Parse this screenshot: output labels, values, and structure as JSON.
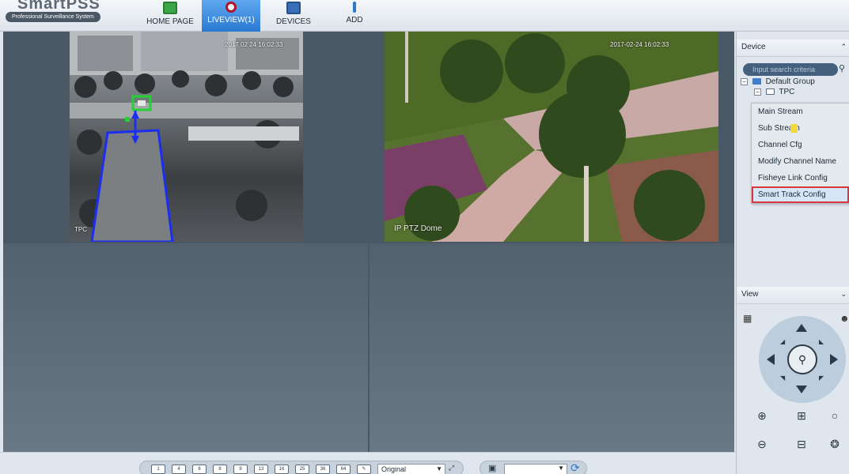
{
  "app": {
    "logo_text": "SmartPSS",
    "subtitle": "Professional Surveillance System"
  },
  "nav": {
    "tabs": [
      {
        "label": "HOME PAGE",
        "icon": "home-icon"
      },
      {
        "label": "LIVEVIEW(1)",
        "icon": "record-icon"
      },
      {
        "label": "DEVICES",
        "icon": "monitor-icon"
      },
      {
        "label": "ADD",
        "icon": "plus-icon"
      }
    ],
    "active_tab": "LIVEVIEW(1)"
  },
  "video": {
    "cells": [
      {
        "timestamp": "2017 02 24 16:02:33",
        "channel": "TPC"
      },
      {
        "timestamp": "2017-02-24 16:02:33",
        "channel": "IP PTZ Dome"
      },
      {},
      {}
    ]
  },
  "device_panel": {
    "title": "Device",
    "search_placeholder": "Input search criteria",
    "tree": [
      {
        "label": "Default Group",
        "expanded": true
      },
      {
        "label": "TPC",
        "expanded": true
      }
    ],
    "context_menu": [
      "Main Stream",
      "Sub Stream",
      "Channel Cfg",
      "Modify Channel Name",
      "Fisheye Link Config",
      "Smart Track Config"
    ],
    "highlighted_item": "Smart Track Config"
  },
  "view_panel": {
    "title": "View"
  },
  "toolbar": {
    "layouts": [
      "1",
      "4",
      "6",
      "8",
      "9",
      "13",
      "16",
      "25",
      "36",
      "64"
    ],
    "ratio_value": "Original"
  },
  "colors": {
    "accent": "#2a79d1",
    "highlight_border": "#d9363e",
    "video_bg": "#4a5866",
    "tracking_box": "#1c2ef0"
  }
}
